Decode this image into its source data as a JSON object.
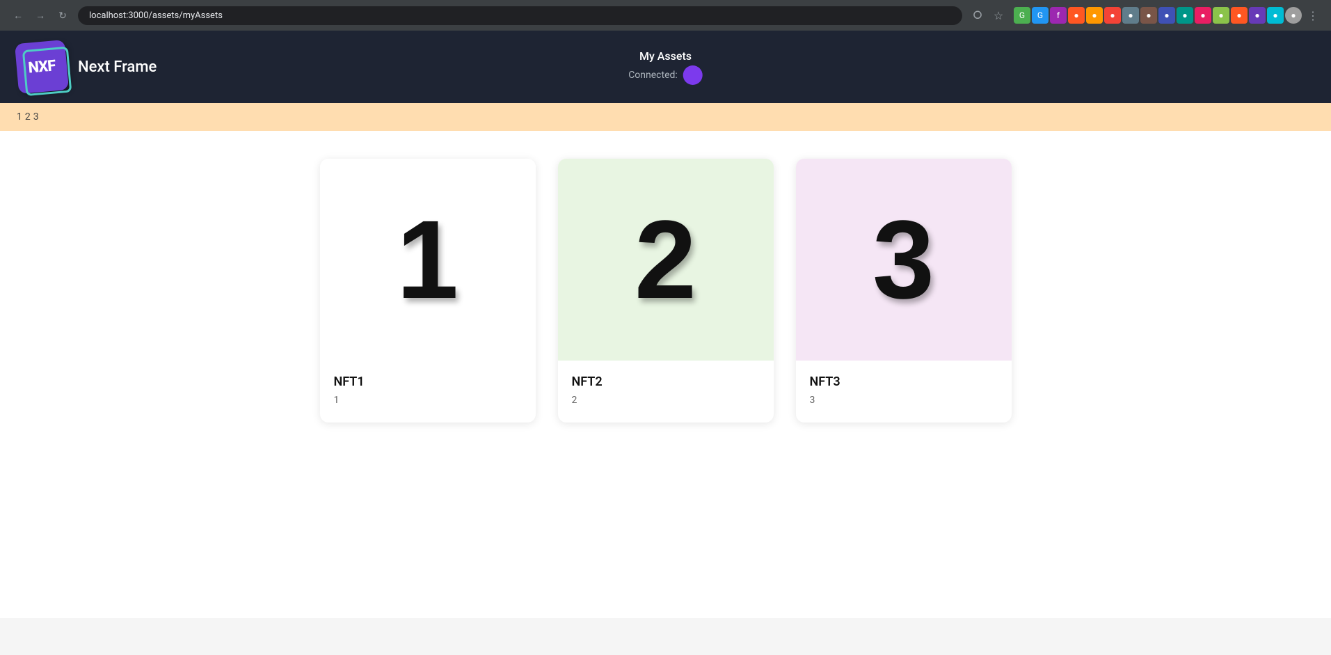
{
  "browser": {
    "url": "localhost:3000/assets/myAssets",
    "back_btn": "←",
    "forward_btn": "→",
    "reload_btn": "↺"
  },
  "header": {
    "logo_text": "NXF",
    "app_title": "Next Frame",
    "page_title": "My Assets",
    "connected_label": "Connected:"
  },
  "breadcrumb": {
    "items": [
      "1",
      "2",
      "3"
    ]
  },
  "nfts": [
    {
      "id": "1",
      "name": "NFT1",
      "number": "1",
      "bg_class": "nft-image-1"
    },
    {
      "id": "2",
      "name": "NFT2",
      "number": "2",
      "bg_class": "nft-image-2"
    },
    {
      "id": "3",
      "name": "NFT3",
      "number": "3",
      "bg_class": "nft-image-3"
    }
  ]
}
